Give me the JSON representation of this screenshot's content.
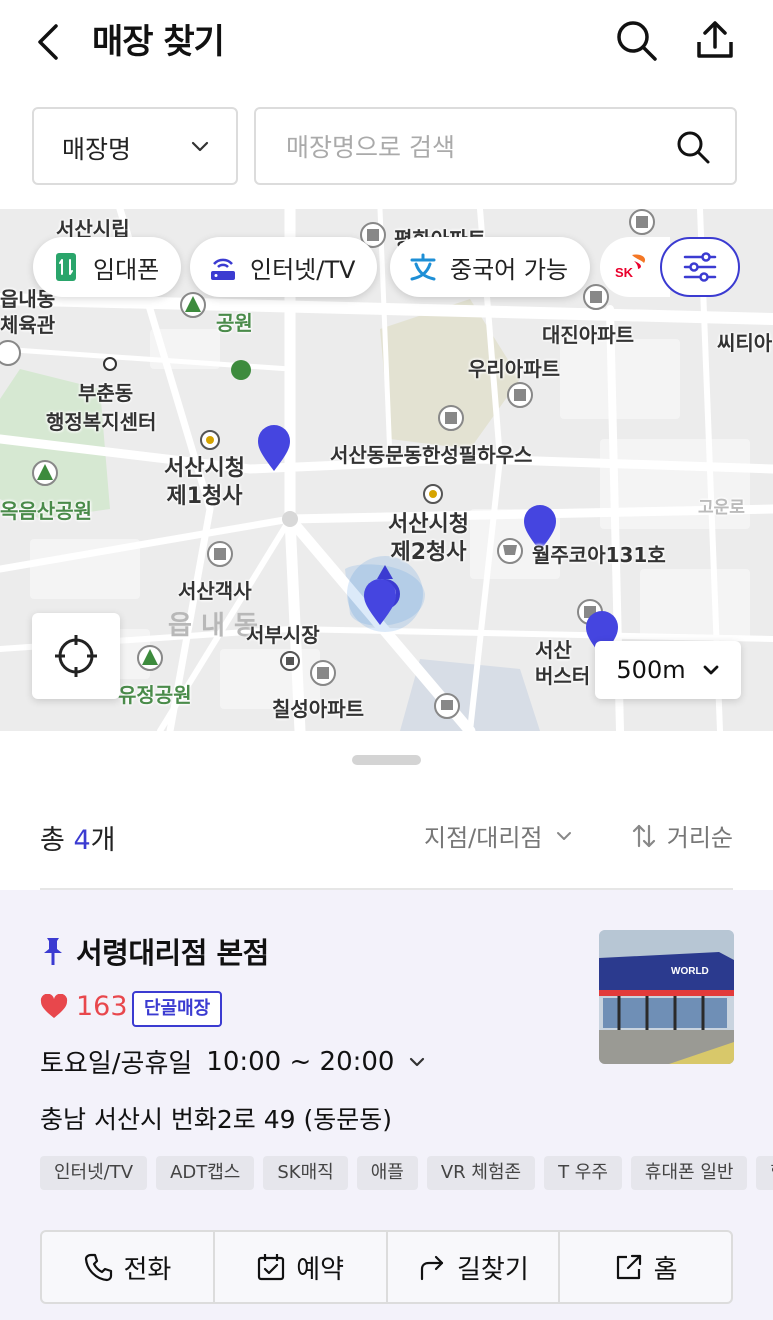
{
  "header": {
    "title": "매장 찾기"
  },
  "search": {
    "select_label": "매장명",
    "placeholder": "매장명으로 검색",
    "value": ""
  },
  "filters": {
    "chips": [
      {
        "label": "임대폰",
        "icon": "phone-rental-icon"
      },
      {
        "label": "인터넷/TV",
        "icon": "router-icon"
      },
      {
        "label": "중국어 가능",
        "icon": "chinese-language-icon"
      }
    ],
    "partner_logo": "SK"
  },
  "map": {
    "scale": "500m",
    "labels": {
      "seosan_city_hall_top": "서산시립",
      "apartment_top": "평화아파트",
      "eupnae": "읍내동",
      "sports": "체육관",
      "park_top": "공원",
      "daejin": "대진아파트",
      "citi": "씨티아",
      "uri": "우리아파트",
      "buchun_dong": "부춘동",
      "admin_center": "행정복지센터",
      "city_hall_1": "서산시청\n제1청사",
      "hansung": "서산동문동한성필하우스",
      "okeumsan": "옥음산공원",
      "city_hall_2": "서산시청\n제2청사",
      "goun": "고운로",
      "core": "월주코아131호",
      "gaeksa": "서산객사",
      "eupnae_faint": "읍 내 동",
      "market": "서부시장",
      "terminal": "서산\n버스터",
      "yujeong": "유정공원",
      "chilseong": "칠성아파트"
    }
  },
  "results": {
    "total_prefix": "총",
    "total_count": "4",
    "total_suffix": "개",
    "type_filter": "지점/대리점",
    "sort": "거리순"
  },
  "store": {
    "name": "서령대리점 본점",
    "likes": "163",
    "badge": "단골매장",
    "days": "토요일/공휴일",
    "hours": "10:00 ~ 20:00",
    "address": "충남 서산시 번화2로 49 (동문동)",
    "tags": [
      "인터넷/TV",
      "ADT캡스",
      "SK매직",
      "애플",
      "VR 체험존",
      "T 우주",
      "휴대폰 일반",
      "행"
    ],
    "actions": {
      "call": "전화",
      "reserve": "예약",
      "directions": "길찾기",
      "home": "홈"
    }
  },
  "colors": {
    "accent": "#3b3bd1",
    "heart": "#e8474c",
    "card_bg": "#f3f2fa"
  }
}
